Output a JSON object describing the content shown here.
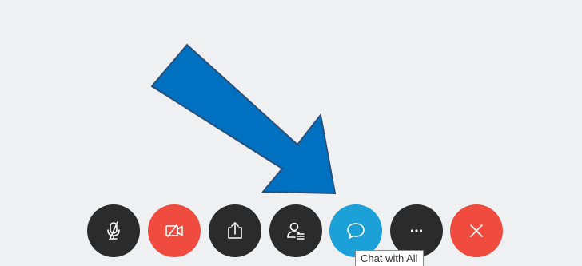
{
  "colors": {
    "background": "#eff0f1",
    "arrow_fill": "#0070c0",
    "arrow_stroke": "#2a4f7a",
    "dark_button": "#2b2b2b",
    "video_button": "#ef4b3f",
    "chat_button": "#1ba0d7",
    "leave_button": "#f04b3f",
    "icon_color": "#ffffff"
  },
  "toolbar": {
    "buttons": [
      {
        "id": "mute",
        "icon": "microphone-muted-icon"
      },
      {
        "id": "video",
        "icon": "video-off-icon"
      },
      {
        "id": "share",
        "icon": "share-upload-icon"
      },
      {
        "id": "participants",
        "icon": "participants-icon"
      },
      {
        "id": "chat",
        "icon": "chat-bubble-icon"
      },
      {
        "id": "more",
        "icon": "more-options-icon"
      },
      {
        "id": "leave",
        "icon": "close-icon"
      }
    ]
  },
  "tooltip": {
    "text": "Chat with All"
  },
  "annotation": {
    "icon": "pointer-arrow"
  }
}
